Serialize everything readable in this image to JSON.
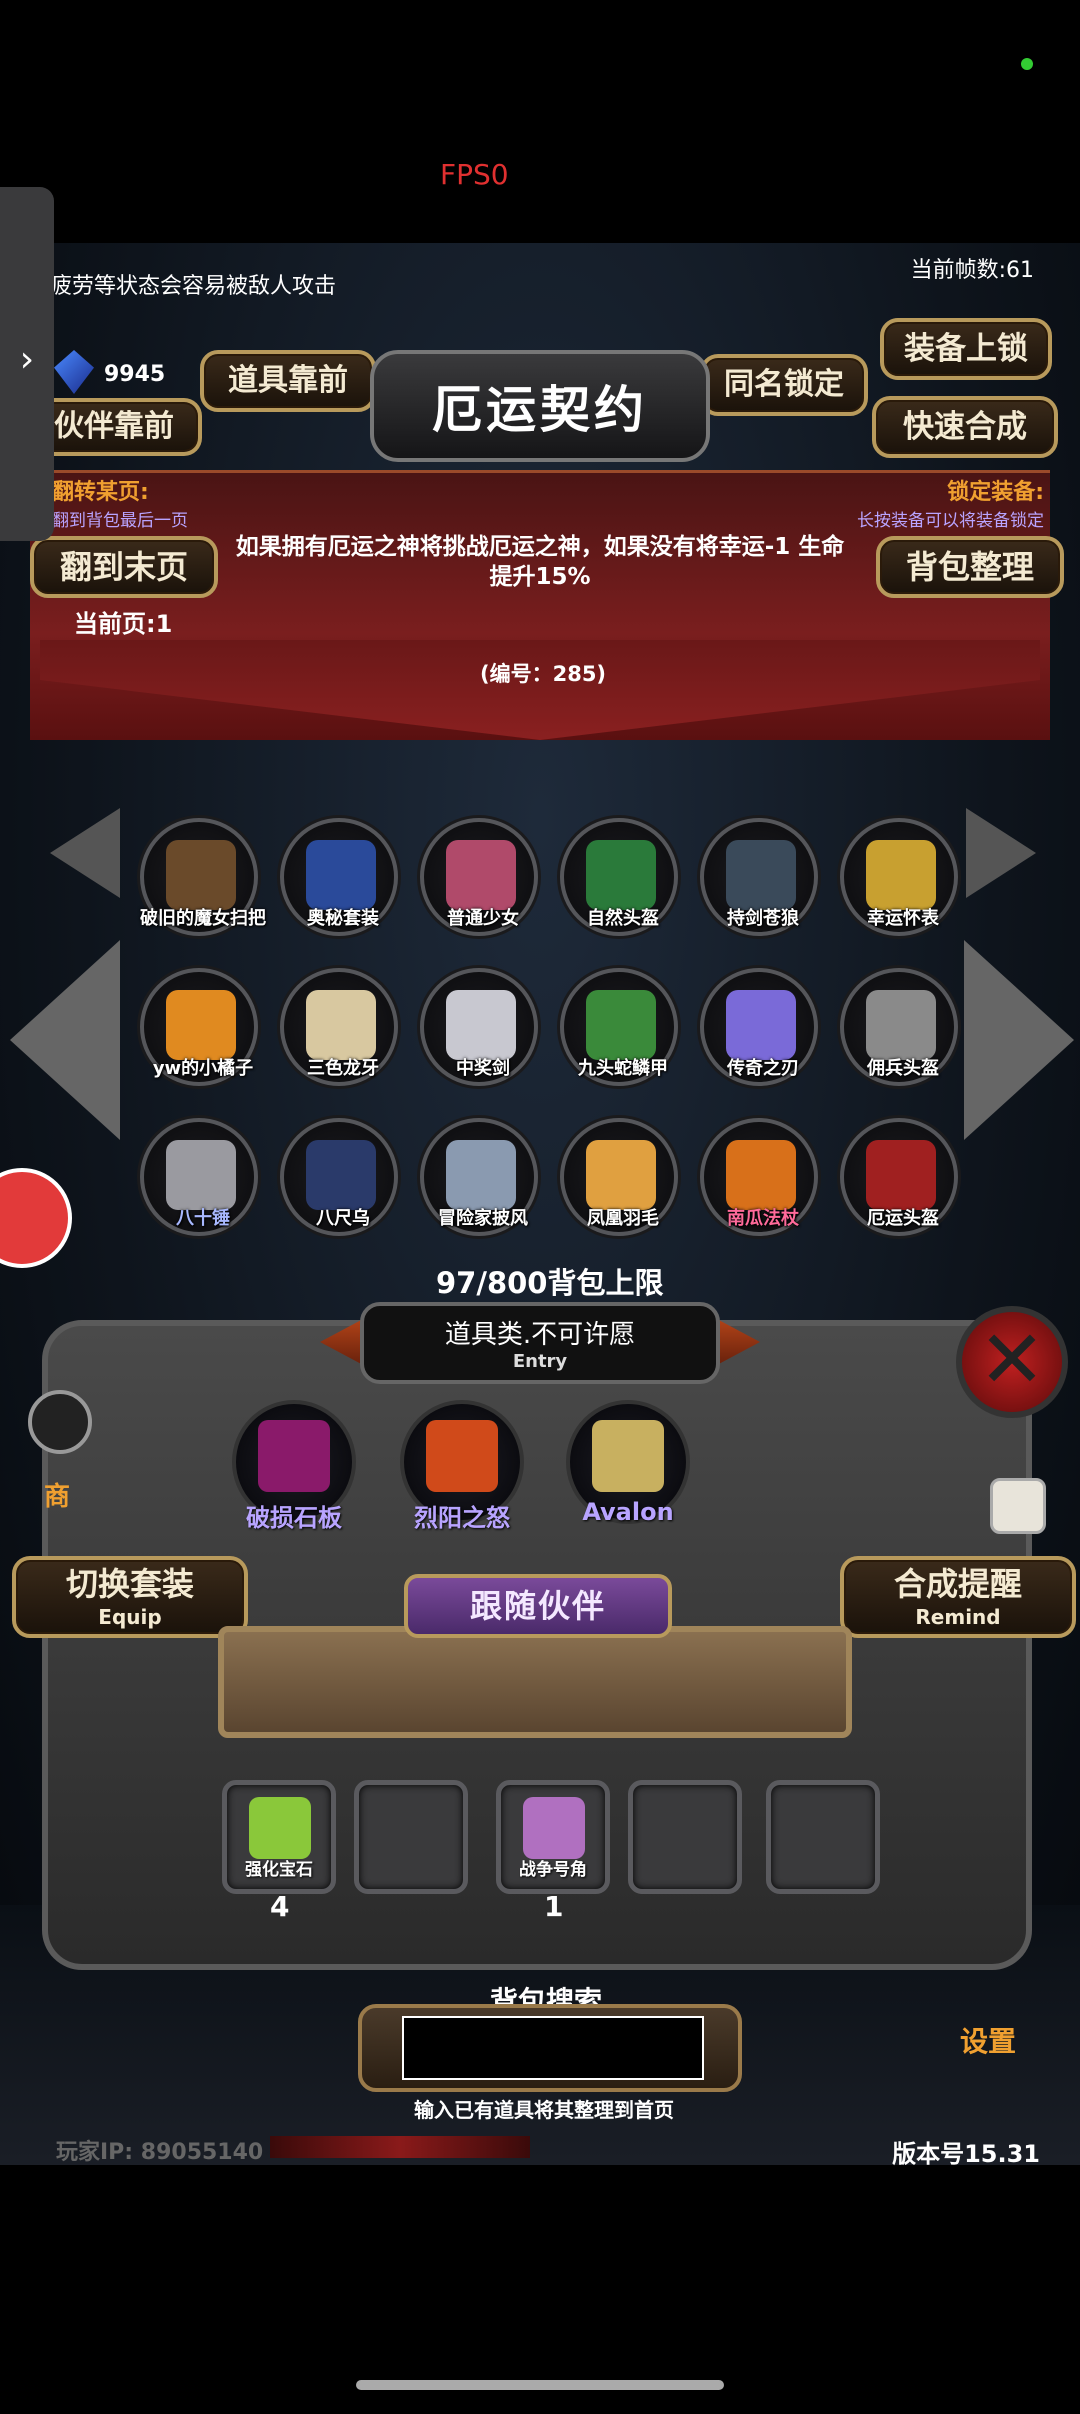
{
  "status": {
    "fps": "FPS0"
  },
  "hud": {
    "top_hint": "疲劳等状态会容易被敌人攻击",
    "frames": "当前帧数:61",
    "gem_count": "9945",
    "jump_label": "翻转某页:",
    "jump_sub": "翻到背包最后一页",
    "lock_label": "锁定装备:",
    "lock_sub": "长按装备可以将装备锁定",
    "current_page": "当前页:1",
    "player_ip": "玩家IP:  89055140",
    "version": "版本号15.31",
    "settings": "设置",
    "shop": "商"
  },
  "buttons": {
    "items_front": "道具靠前",
    "partner_front": "伙伴靠前",
    "same_name_lock": "同名锁定",
    "equip_lock": "装备上锁",
    "quick_merge": "快速合成",
    "last_page": "翻到末页",
    "bag_sort": "背包整理",
    "switch_set": "切换套装",
    "switch_set_sub": "Equip",
    "merge_remind": "合成提醒",
    "merge_remind_sub": "Remind",
    "follow_partner": "跟随伙伴"
  },
  "item_detail": {
    "title": "厄运契约",
    "description": "如果拥有厄运之神将挑战厄运之神，如果没有将幸运-1 生命提升15%",
    "item_id": "(编号：285)",
    "category": "道具类.不可许愿",
    "entry_label": "Entry"
  },
  "inventory": {
    "capacity": "97/800背包上限",
    "items": [
      {
        "name": "破旧的魔女扫把",
        "icon": "broom-icon",
        "color": "#6a4a2a",
        "label_color": "#ffffff"
      },
      {
        "name": "奥秘套装",
        "icon": "robe-icon",
        "color": "#2a4a9a",
        "label_color": "#ffffff"
      },
      {
        "name": "普通少女",
        "icon": "girl-icon",
        "color": "#b04a6a",
        "label_color": "#ffffff"
      },
      {
        "name": "自然头盔",
        "icon": "leaf-helmet-icon",
        "color": "#2a7a3a",
        "label_color": "#ffffff"
      },
      {
        "name": "持剑苍狼",
        "icon": "wolf-icon",
        "color": "#3a4a5a",
        "label_color": "#ffffff"
      },
      {
        "name": "幸运怀表",
        "icon": "pocket-watch-icon",
        "color": "#c8a030",
        "label_color": "#ffffff"
      },
      {
        "name": "yw的小橘子",
        "icon": "orange-icon",
        "color": "#e08a20",
        "label_color": "#ffffff"
      },
      {
        "name": "三色龙牙",
        "icon": "fang-icon",
        "color": "#d8c8a0",
        "label_color": "#ffffff"
      },
      {
        "name": "中奖剑",
        "icon": "sword-icon",
        "color": "#c8c8d0",
        "label_color": "#ffffff"
      },
      {
        "name": "九头蛇鳞甲",
        "icon": "hydra-armor-icon",
        "color": "#3a8a3a",
        "label_color": "#ffffff"
      },
      {
        "name": "传奇之刃",
        "icon": "blade-icon",
        "color": "#7a6ad8",
        "label_color": "#ffffff"
      },
      {
        "name": "佣兵头盔",
        "icon": "helmet-icon",
        "color": "#8a8a8a",
        "label_color": "#ffffff"
      },
      {
        "name": "八十锤",
        "icon": "hammer-icon",
        "color": "#9a9aa0",
        "label_color": "#a8b8ff"
      },
      {
        "name": "八尺乌",
        "icon": "crow-icon",
        "color": "#2a3a6a",
        "label_color": "#ffffff"
      },
      {
        "name": "冒险家披风",
        "icon": "cloak-icon",
        "color": "#8a9ab0",
        "label_color": "#ffffff"
      },
      {
        "name": "凤凰羽毛",
        "icon": "feather-icon",
        "color": "#e0a040",
        "label_color": "#ffffff"
      },
      {
        "name": "南瓜法杖",
        "icon": "pumpkin-staff-icon",
        "color": "#d8701a",
        "label_color": "#ff6a9a"
      },
      {
        "name": "厄运头盔",
        "icon": "doom-helmet-icon",
        "color": "#a02020",
        "label_color": "#ffffff"
      }
    ]
  },
  "equipped": [
    {
      "name": "破损石板",
      "icon": "broken-slab-icon",
      "color": "#8a1a6a"
    },
    {
      "name": "烈阳之怒",
      "icon": "sun-crown-icon",
      "color": "#d04a1a"
    },
    {
      "name": "Avalon",
      "icon": "avalon-sword-icon",
      "color": "#c8b060"
    }
  ],
  "bottom_slots": [
    {
      "name": "强化宝石",
      "icon": "gem-icon",
      "color": "#8ac83a",
      "count": "4"
    },
    {
      "name": "",
      "icon": "",
      "color": "",
      "count": ""
    },
    {
      "name": "战争号角",
      "icon": "horn-icon",
      "color": "#b070c0",
      "count": "1"
    },
    {
      "name": "",
      "icon": "",
      "color": "",
      "count": ""
    },
    {
      "name": "",
      "icon": "",
      "color": "",
      "count": ""
    }
  ],
  "search": {
    "title": "背包搜索",
    "value": "",
    "hint": "输入已有道具将其整理到首页"
  }
}
